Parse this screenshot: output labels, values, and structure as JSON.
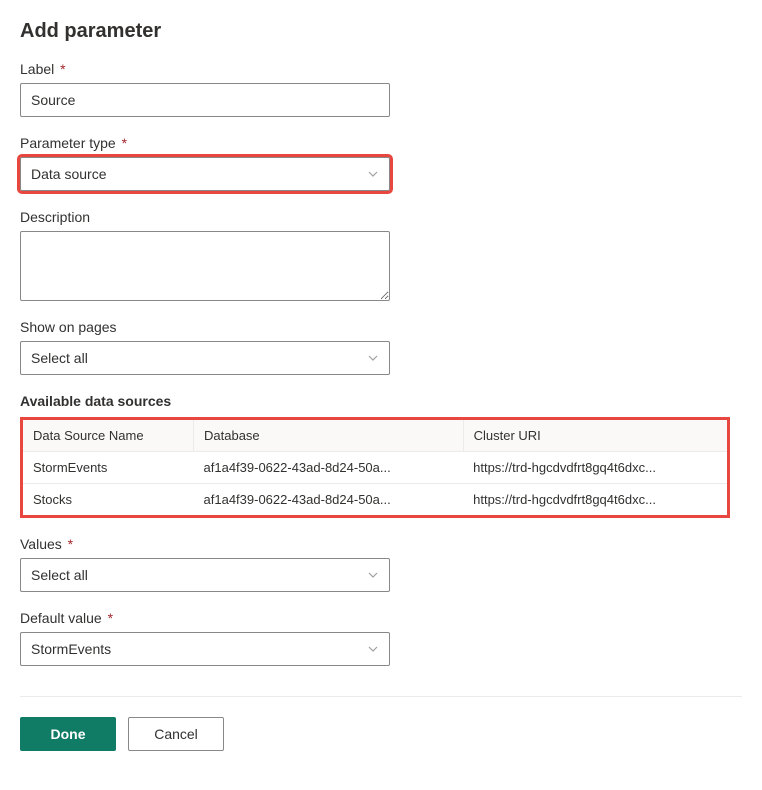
{
  "title": "Add parameter",
  "fields": {
    "label": {
      "label": "Label",
      "required": true,
      "value": "Source"
    },
    "parameter_type": {
      "label": "Parameter type",
      "required": true,
      "value": "Data source"
    },
    "description": {
      "label": "Description",
      "required": false,
      "value": ""
    },
    "show_on_pages": {
      "label": "Show on pages",
      "required": false,
      "value": "Select all"
    },
    "values": {
      "label": "Values",
      "required": true,
      "value": "Select all"
    },
    "default_value": {
      "label": "Default value",
      "required": true,
      "value": "StormEvents"
    }
  },
  "available_sources": {
    "title": "Available data sources",
    "columns": [
      "Data Source Name",
      "Database",
      "Cluster URI"
    ],
    "rows": [
      {
        "name": "StormEvents",
        "database": "af1a4f39-0622-43ad-8d24-50a...",
        "cluster": "https://trd-hgcdvdfrt8gq4t6dxc..."
      },
      {
        "name": "Stocks",
        "database": "af1a4f39-0622-43ad-8d24-50a...",
        "cluster": "https://trd-hgcdvdfrt8gq4t6dxc..."
      }
    ]
  },
  "buttons": {
    "done": "Done",
    "cancel": "Cancel"
  },
  "required_marker": "*"
}
